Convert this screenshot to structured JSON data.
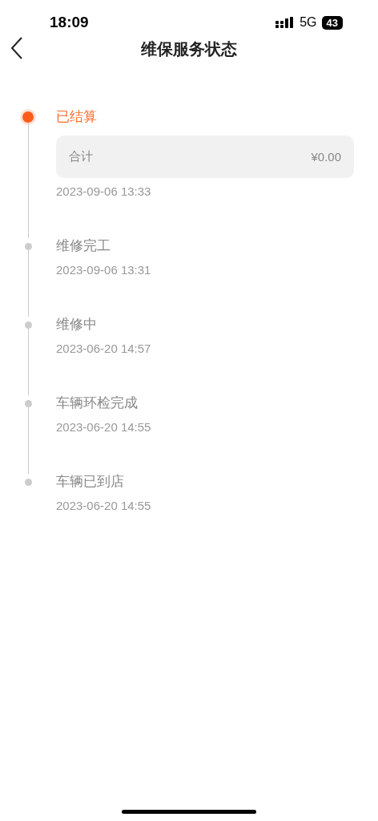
{
  "status_bar": {
    "time": "18:09",
    "network": "5G",
    "battery": "43"
  },
  "nav": {
    "title": "维保服务状态"
  },
  "timeline": [
    {
      "title": "已结算",
      "time": "2023-09-06 13:33",
      "current": true,
      "summary": {
        "label": "合计",
        "amount": "¥0.00"
      }
    },
    {
      "title": "维修完工",
      "time": "2023-09-06 13:31",
      "current": false
    },
    {
      "title": "维修中",
      "time": "2023-06-20 14:57",
      "current": false
    },
    {
      "title": "车辆环检完成",
      "time": "2023-06-20 14:55",
      "current": false
    },
    {
      "title": "车辆已到店",
      "time": "2023-06-20 14:55",
      "current": false
    }
  ]
}
